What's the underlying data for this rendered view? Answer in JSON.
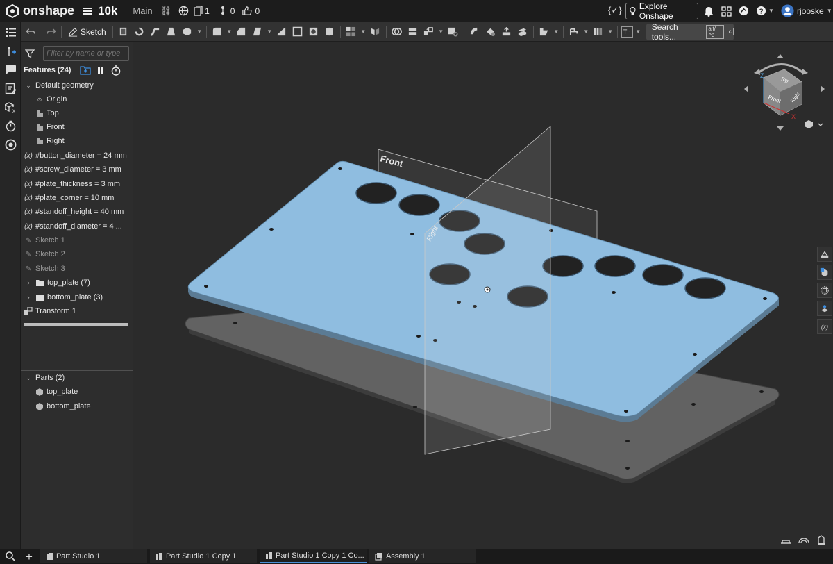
{
  "app": {
    "brand": "onshape",
    "doc_name": "10k",
    "branch": "Main",
    "versions_count": "1",
    "branches_count": "0",
    "likes_count": "0",
    "explore_label": "Explore Onshape",
    "username": "rjooske"
  },
  "toolbar": {
    "sketch_label": "Sketch",
    "th_label": "Th",
    "search_label": "Search tools...",
    "shortcut_alt": "alt/⌥",
    "shortcut_c": "c"
  },
  "features": {
    "header": "Features (24)",
    "filter_placeholder": "Filter by name or type",
    "default_geometry": "Default geometry",
    "items": [
      {
        "label": "Origin"
      },
      {
        "label": "Top"
      },
      {
        "label": "Front"
      },
      {
        "label": "Right"
      },
      {
        "label": "#button_diameter = 24 mm"
      },
      {
        "label": "#screw_diameter = 3 mm"
      },
      {
        "label": "#plate_thickness = 3 mm"
      },
      {
        "label": "#plate_corner = 10 mm"
      },
      {
        "label": "#standoff_height = 40 mm"
      },
      {
        "label": "#standoff_diameter = 4 ..."
      },
      {
        "label": "Sketch 1"
      },
      {
        "label": "Sketch 2"
      },
      {
        "label": "Sketch 3"
      },
      {
        "label": "top_plate (7)"
      },
      {
        "label": "bottom_plate (3)"
      },
      {
        "label": "Transform 1"
      }
    ]
  },
  "parts": {
    "header": "Parts (2)",
    "items": [
      {
        "label": "top_plate"
      },
      {
        "label": "bottom_plate"
      }
    ]
  },
  "viewport": {
    "plane_front": "Front",
    "plane_right": "Right",
    "cube_front": "Front",
    "cube_top": "Top",
    "cube_right": "Right",
    "axis_z": "Z",
    "axis_x": "X"
  },
  "tabs": [
    {
      "label": "Part Studio 1"
    },
    {
      "label": "Part Studio 1 Copy 1"
    },
    {
      "label": "Part Studio 1 Copy 1 Co..."
    },
    {
      "label": "Assembly 1"
    }
  ],
  "colors": {
    "plate_top": "#8fbde0",
    "plate_bottom": "#8f8f8f",
    "accent": "#4a90d9"
  }
}
